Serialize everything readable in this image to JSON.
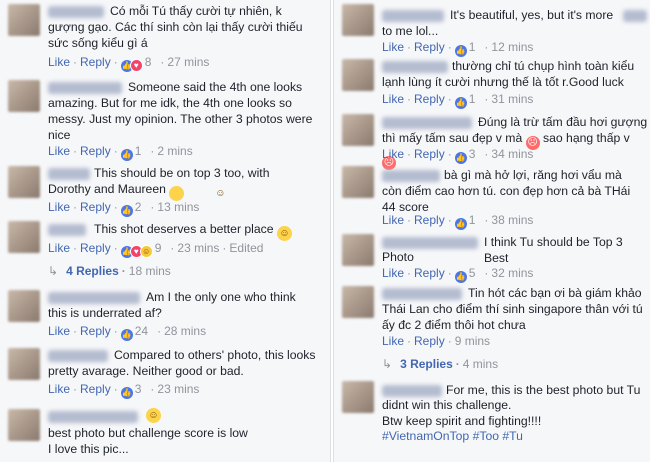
{
  "left": [
    {
      "text": "Có mỗi Tú thấy cười tự nhiên, k gượng gạo. Các thí sinh còn lại thấy cười thiếu sức sống kiểu gì á",
      "likes": "8",
      "time": "27 mins"
    },
    {
      "text": "Someone said the 4th one looks amazing. But for me idk, the 4th one looks so messy. Just my opinion. The other 3 photos were nice",
      "likes": "1",
      "time": "2 mins"
    },
    {
      "text": "This should be on top 3 too, with Dorothy and Maureen",
      "likes": "2",
      "time": "13 mins"
    },
    {
      "text": "This shot deserves a better place",
      "likes": "9",
      "time": "23 mins",
      "edited": "Edited",
      "replies": "4 Replies",
      "replies_time": "18 mins"
    },
    {
      "text": "Am I the only one who think this is underrated af?",
      "likes": "24",
      "time": "28 mins"
    },
    {
      "text": "Compared to others' photo, this looks pretty avarage. Neither good or bad.",
      "likes": "3",
      "time": "23 mins"
    },
    {
      "text1": "best photo but challenge score is low",
      "text2": "I love this pic..."
    }
  ],
  "right": [
    {
      "text1": "It's beautiful, yes, but it's more",
      "text2": "to me lol...",
      "likes": "1",
      "time": "12 mins"
    },
    {
      "text": "thường chỉ tú chụp hình toàn kiểu lạnh lùng ít cười nhưng thế là tốt r.Good luck",
      "likes": "1",
      "time": "31 mins"
    },
    {
      "text1": "Đúng là trừ tấm đầu hơi gượng",
      "text2": "thì mấy tấm sau đẹp v mà",
      "text3": "sao hạng thấp v",
      "likes": "3",
      "time": "34 mins"
    },
    {
      "text": "bà gì mà hở lợi, răng hơi vẩu mà còn điểm cao hơn tú. con đẹp hơn cả bà THái 44 score",
      "likes": "1",
      "time": "38 mins"
    },
    {
      "text1": "I think Tu should be Top 3 Best",
      "text2": "Photo",
      "likes": "5",
      "time": "32 mins"
    },
    {
      "text1": "Tin hót các bạn ơi bà giám khảo",
      "text2": "Thái Lan cho điểm thí sinh singapore thân với tú ấy đc 2 điểm thôi hot chưa",
      "time": "9 mins",
      "replies": "3 Replies",
      "replies_time": "4 mins"
    },
    {
      "text1": "For me, this is the best photo but Tu",
      "text2": "didnt win this challenge.",
      "text3": "Btw keep spirit and fighting!!!!",
      "tags": [
        "#VietnamOnTop",
        "#Too",
        "#Tu"
      ]
    }
  ],
  "labels": {
    "like": "Like",
    "reply": "Reply",
    "dot": "·"
  }
}
